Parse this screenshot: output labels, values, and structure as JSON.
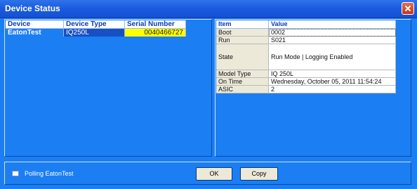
{
  "window": {
    "title": "Device Status"
  },
  "devices": {
    "headers": {
      "device": "Device",
      "type": "Device Type",
      "serial": "Serial Number"
    },
    "rows": [
      {
        "device": "EatonTest",
        "type": "IQ250L",
        "serial": "0040466727"
      }
    ]
  },
  "details": {
    "headers": {
      "item": "Item",
      "value": "Value"
    },
    "rows": [
      {
        "item": "Boot",
        "value": "0002"
      },
      {
        "item": "Run",
        "value": "S021"
      },
      {
        "item": "State",
        "value": "Run Mode | Logging Enabled"
      },
      {
        "item": "Model Type",
        "value": "IQ 250L"
      },
      {
        "item": "On Time",
        "value": "Wednesday, October 05, 2011 11:54:24"
      },
      {
        "item": "ASIC",
        "value": "2"
      }
    ]
  },
  "footer": {
    "polling_label": "Polling EatonTest",
    "ok_label": "OK",
    "copy_label": "Copy"
  },
  "colors": {
    "window_bg": "#1b7ef3",
    "title_bar": "#1b5ce0",
    "serial_highlight": "#ffff00",
    "selected_cell": "#1650c2"
  }
}
